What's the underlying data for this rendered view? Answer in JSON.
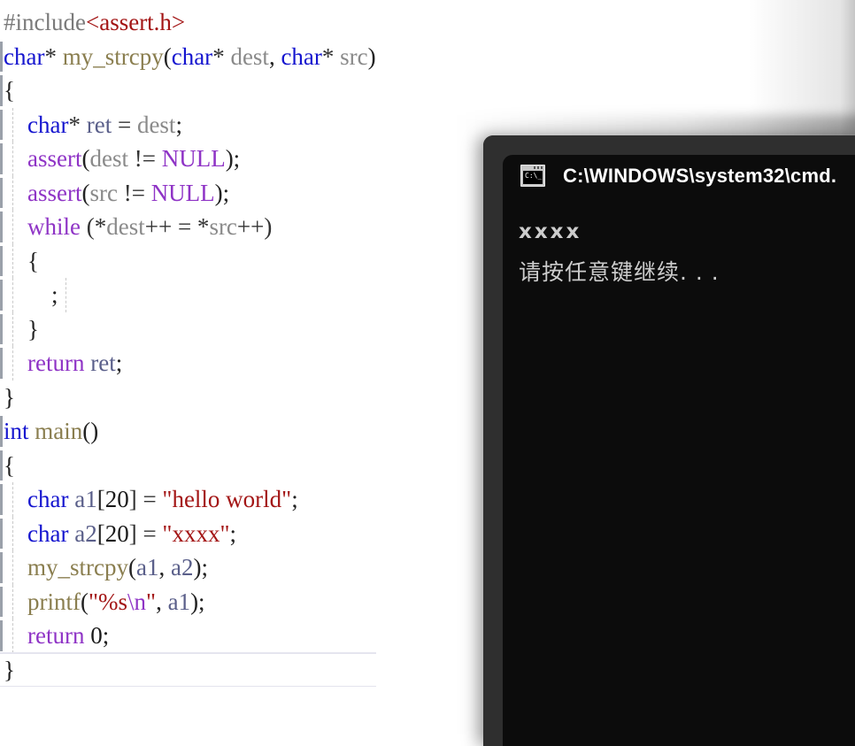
{
  "editor": {
    "language": "c",
    "lines": [
      {
        "indent_guides": 0,
        "changed": false,
        "current": false,
        "tokens": [
          {
            "text": "#include",
            "cls": "t-pre"
          },
          {
            "text": "<assert.h>",
            "cls": "t-inc"
          }
        ]
      },
      {
        "indent_guides": 0,
        "changed": true,
        "current": false,
        "tokens": [
          {
            "text": "char",
            "cls": "t-kw"
          },
          {
            "text": "* ",
            "cls": "t-op"
          },
          {
            "text": "my_strcpy",
            "cls": "t-fn"
          },
          {
            "text": "(",
            "cls": "t-punc"
          },
          {
            "text": "char",
            "cls": "t-kw"
          },
          {
            "text": "* ",
            "cls": "t-op"
          },
          {
            "text": "dest",
            "cls": "t-id"
          },
          {
            "text": ", ",
            "cls": "t-punc"
          },
          {
            "text": "char",
            "cls": "t-kw"
          },
          {
            "text": "* ",
            "cls": "t-op"
          },
          {
            "text": "src",
            "cls": "t-id"
          },
          {
            "text": ")",
            "cls": "t-punc"
          }
        ]
      },
      {
        "indent_guides": 0,
        "changed": true,
        "current": false,
        "tokens": [
          {
            "text": "{",
            "cls": "t-punc"
          }
        ]
      },
      {
        "indent_guides": 1,
        "changed": true,
        "current": false,
        "tokens": [
          {
            "text": "    ",
            "cls": "t-punc"
          },
          {
            "text": "char",
            "cls": "t-kw"
          },
          {
            "text": "* ",
            "cls": "t-op"
          },
          {
            "text": "ret",
            "cls": "t-var"
          },
          {
            "text": " = ",
            "cls": "t-op"
          },
          {
            "text": "dest",
            "cls": "t-id"
          },
          {
            "text": ";",
            "cls": "t-punc"
          }
        ]
      },
      {
        "indent_guides": 1,
        "changed": true,
        "current": false,
        "tokens": [
          {
            "text": "    ",
            "cls": "t-punc"
          },
          {
            "text": "assert",
            "cls": "t-ctl"
          },
          {
            "text": "(",
            "cls": "t-punc"
          },
          {
            "text": "dest",
            "cls": "t-id"
          },
          {
            "text": " != ",
            "cls": "t-op"
          },
          {
            "text": "NULL",
            "cls": "t-ctl"
          },
          {
            "text": ");",
            "cls": "t-punc"
          }
        ]
      },
      {
        "indent_guides": 1,
        "changed": true,
        "current": false,
        "tokens": [
          {
            "text": "    ",
            "cls": "t-punc"
          },
          {
            "text": "assert",
            "cls": "t-ctl"
          },
          {
            "text": "(",
            "cls": "t-punc"
          },
          {
            "text": "src",
            "cls": "t-id"
          },
          {
            "text": " != ",
            "cls": "t-op"
          },
          {
            "text": "NULL",
            "cls": "t-ctl"
          },
          {
            "text": ");",
            "cls": "t-punc"
          }
        ]
      },
      {
        "indent_guides": 1,
        "changed": true,
        "current": false,
        "tokens": [
          {
            "text": "    ",
            "cls": "t-punc"
          },
          {
            "text": "while",
            "cls": "t-ctl"
          },
          {
            "text": " (*",
            "cls": "t-op"
          },
          {
            "text": "dest",
            "cls": "t-id"
          },
          {
            "text": "++ = *",
            "cls": "t-op"
          },
          {
            "text": "src",
            "cls": "t-id"
          },
          {
            "text": "++)",
            "cls": "t-op"
          }
        ]
      },
      {
        "indent_guides": 1,
        "changed": true,
        "current": false,
        "tokens": [
          {
            "text": "    {",
            "cls": "t-punc"
          }
        ]
      },
      {
        "indent_guides": 2,
        "changed": true,
        "current": false,
        "tokens": [
          {
            "text": "        ;",
            "cls": "t-punc"
          }
        ]
      },
      {
        "indent_guides": 1,
        "changed": true,
        "current": false,
        "tokens": [
          {
            "text": "    }",
            "cls": "t-punc"
          }
        ]
      },
      {
        "indent_guides": 1,
        "changed": true,
        "current": false,
        "tokens": [
          {
            "text": "    ",
            "cls": "t-punc"
          },
          {
            "text": "return",
            "cls": "t-ctl"
          },
          {
            "text": " ",
            "cls": "t-op"
          },
          {
            "text": "ret",
            "cls": "t-var"
          },
          {
            "text": ";",
            "cls": "t-punc"
          }
        ]
      },
      {
        "indent_guides": 0,
        "changed": false,
        "current": false,
        "tokens": [
          {
            "text": "}",
            "cls": "t-punc"
          }
        ]
      },
      {
        "indent_guides": 0,
        "changed": true,
        "current": false,
        "tokens": [
          {
            "text": "int",
            "cls": "t-kw"
          },
          {
            "text": " ",
            "cls": "t-op"
          },
          {
            "text": "main",
            "cls": "t-fn"
          },
          {
            "text": "()",
            "cls": "t-punc"
          }
        ]
      },
      {
        "indent_guides": 0,
        "changed": true,
        "current": false,
        "tokens": [
          {
            "text": "{",
            "cls": "t-punc"
          }
        ]
      },
      {
        "indent_guides": 1,
        "changed": true,
        "current": false,
        "tokens": [
          {
            "text": "    ",
            "cls": "t-punc"
          },
          {
            "text": "char",
            "cls": "t-kw"
          },
          {
            "text": " ",
            "cls": "t-op"
          },
          {
            "text": "a1",
            "cls": "t-var"
          },
          {
            "text": "[",
            "cls": "t-punc"
          },
          {
            "text": "20",
            "cls": "t-num"
          },
          {
            "text": "] = ",
            "cls": "t-op"
          },
          {
            "text": "\"hello world\"",
            "cls": "t-str"
          },
          {
            "text": ";",
            "cls": "t-punc"
          }
        ]
      },
      {
        "indent_guides": 1,
        "changed": true,
        "current": false,
        "tokens": [
          {
            "text": "    ",
            "cls": "t-punc"
          },
          {
            "text": "char",
            "cls": "t-kw"
          },
          {
            "text": " ",
            "cls": "t-op"
          },
          {
            "text": "a2",
            "cls": "t-var"
          },
          {
            "text": "[",
            "cls": "t-punc"
          },
          {
            "text": "20",
            "cls": "t-num"
          },
          {
            "text": "] = ",
            "cls": "t-op"
          },
          {
            "text": "\"xxxx\"",
            "cls": "t-str"
          },
          {
            "text": ";",
            "cls": "t-punc"
          }
        ]
      },
      {
        "indent_guides": 1,
        "changed": true,
        "current": false,
        "tokens": [
          {
            "text": "    ",
            "cls": "t-punc"
          },
          {
            "text": "my_strcpy",
            "cls": "t-fn"
          },
          {
            "text": "(",
            "cls": "t-punc"
          },
          {
            "text": "a1",
            "cls": "t-var"
          },
          {
            "text": ", ",
            "cls": "t-punc"
          },
          {
            "text": "a2",
            "cls": "t-var"
          },
          {
            "text": ");",
            "cls": "t-punc"
          }
        ]
      },
      {
        "indent_guides": 1,
        "changed": true,
        "current": false,
        "tokens": [
          {
            "text": "    ",
            "cls": "t-punc"
          },
          {
            "text": "printf",
            "cls": "t-fn"
          },
          {
            "text": "(",
            "cls": "t-punc"
          },
          {
            "text": "\"%s",
            "cls": "t-str"
          },
          {
            "text": "\\n",
            "cls": "t-ctl"
          },
          {
            "text": "\"",
            "cls": "t-str"
          },
          {
            "text": ", ",
            "cls": "t-punc"
          },
          {
            "text": "a1",
            "cls": "t-var"
          },
          {
            "text": ");",
            "cls": "t-punc"
          }
        ]
      },
      {
        "indent_guides": 1,
        "changed": true,
        "current": false,
        "tokens": [
          {
            "text": "    ",
            "cls": "t-punc"
          },
          {
            "text": "return",
            "cls": "t-ctl"
          },
          {
            "text": " ",
            "cls": "t-op"
          },
          {
            "text": "0",
            "cls": "t-num"
          },
          {
            "text": ";",
            "cls": "t-punc"
          }
        ]
      },
      {
        "indent_guides": 0,
        "changed": false,
        "current": true,
        "tokens": [
          {
            "text": "}",
            "cls": "t-punc"
          }
        ]
      }
    ]
  },
  "console": {
    "icon": "cmd-console-icon",
    "icon_glyph": "C:\\_",
    "title": "C:\\WINDOWS\\system32\\cmd.",
    "output": [
      {
        "text": "xxxx",
        "style": "ascii"
      },
      {
        "text": "请按任意键继续. . .",
        "style": "cjk"
      }
    ],
    "colors": {
      "titlebar": "#2f2f2f",
      "background": "#0c0c0c",
      "text": "#cccccc",
      "title_text": "#ffffff"
    }
  }
}
